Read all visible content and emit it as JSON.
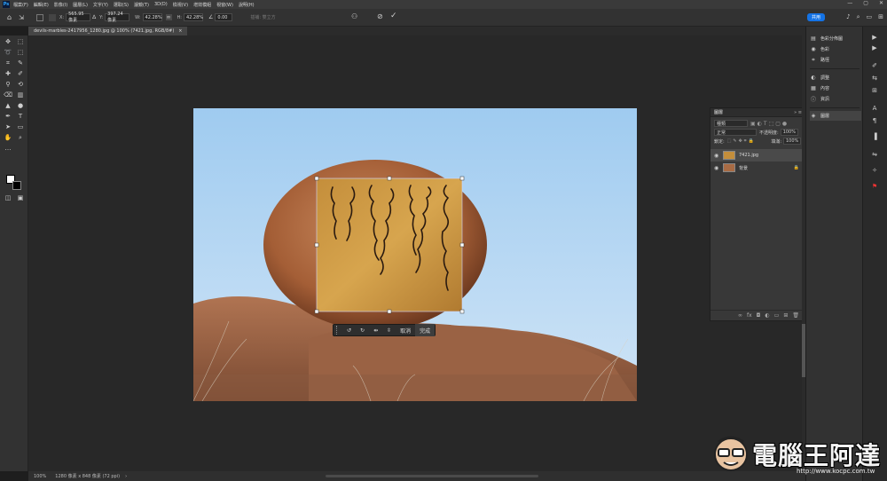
{
  "app": {
    "logo": "Ps"
  },
  "menu": [
    "檔案(F)",
    "編輯(E)",
    "影像(I)",
    "圖層(L)",
    "文字(Y)",
    "選取(S)",
    "濾鏡(T)",
    "3D(D)",
    "檢視(V)",
    "增效模組",
    "視窗(W)",
    "說明(H)"
  ],
  "window_controls": {
    "min": "—",
    "max": "▢",
    "close": "✕"
  },
  "options": {
    "x_label": "X:",
    "x_value": "565.95 像素",
    "y_label": "Y:",
    "y_value": "397.24 像素",
    "w_label": "W:",
    "w_value": "42.28%",
    "h_label": "H:",
    "h_value": "42.28%",
    "angle_value": "0.00",
    "interp_label": "插補: 雙立方",
    "share_label": "共用"
  },
  "doc_tab": {
    "title": "devils-marbles-2417956_1280.jpg @ 100% (7421.jpg, RGB/8#)",
    "close": "×"
  },
  "status": {
    "zoom": "100%",
    "info": "1280 像素 x 848 像素 (72 ppi)",
    "arrow": "›"
  },
  "transform_bar": {
    "cancel": "取消",
    "done": "完成"
  },
  "right_panels": [
    {
      "icon": "layers-comp-icon",
      "glyph": "▤",
      "label": "色彩分佈圖"
    },
    {
      "icon": "color-icon",
      "glyph": "◉",
      "label": "色彩"
    },
    {
      "icon": "swatches-icon",
      "glyph": "⌗",
      "label": "路徑"
    },
    {
      "icon": "adjustments-icon",
      "glyph": "◐",
      "label": "調整"
    },
    {
      "icon": "libraries-icon",
      "glyph": "▦",
      "label": "內容"
    },
    {
      "icon": "info-icon",
      "glyph": "ⓘ",
      "label": "資訊"
    },
    {
      "icon": "layers-icon",
      "glyph": "◈",
      "label": "圖層"
    }
  ],
  "layers_panel": {
    "title": "圖層",
    "search_placeholder": "種類",
    "blend_mode": "正常",
    "opacity_label": "不透明度:",
    "opacity_value": "100%",
    "lock_label": "鎖定:",
    "fill_label": "填滿:",
    "fill_value": "100%",
    "layers": [
      {
        "name": "7421.jpg",
        "selected": true
      },
      {
        "name": "背景",
        "selected": false,
        "locked": true
      }
    ]
  },
  "watermark": {
    "title": "電腦王阿達",
    "url": "http://www.kocpc.com.tw"
  },
  "colors": {
    "accent": "#1473e6",
    "ui_dark": "#323232",
    "canvas": "#282828"
  }
}
